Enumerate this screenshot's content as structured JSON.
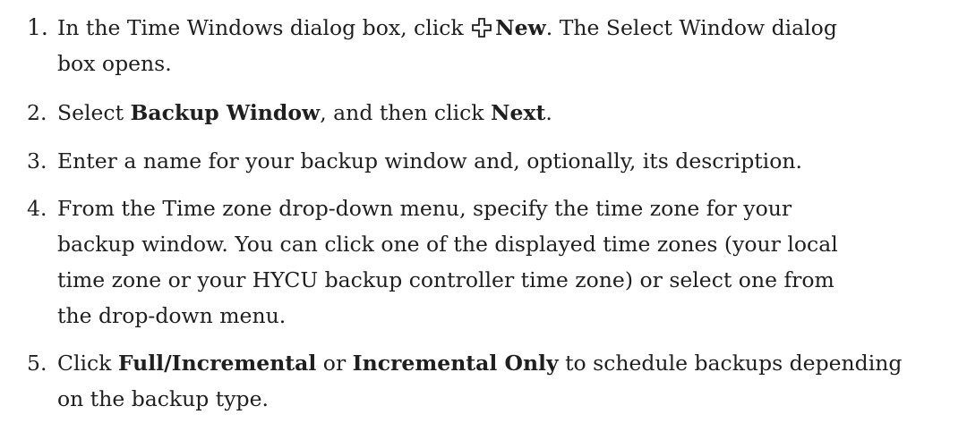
{
  "steps": [
    {
      "number": "1.",
      "t1": "In the Time Windows dialog box, click ",
      "icon": "plus-outline-icon",
      "b1": "New",
      "t2": ". The Select Window dialog",
      "t3": "box opens."
    },
    {
      "number": "2.",
      "t1": "Select ",
      "b1": "Backup Window",
      "t2": ", and then click ",
      "b2": "Next",
      "t3": "."
    },
    {
      "number": "3.",
      "t1": "Enter a name for your backup window and, optionally, its description."
    },
    {
      "number": "4.",
      "lines": [
        "From the Time zone drop-down menu, specify the time zone for your",
        "backup window. You can click one of the displayed time zones (your local",
        "time zone or your HYCU backup controller time zone) or select one from",
        "the drop-down menu."
      ]
    },
    {
      "number": "5.",
      "t1": "Click ",
      "b1": "Full/Incremental",
      "t2": " or ",
      "b2": "Incremental Only",
      "t3": " to schedule backups depending",
      "t4": "on the backup type."
    }
  ]
}
